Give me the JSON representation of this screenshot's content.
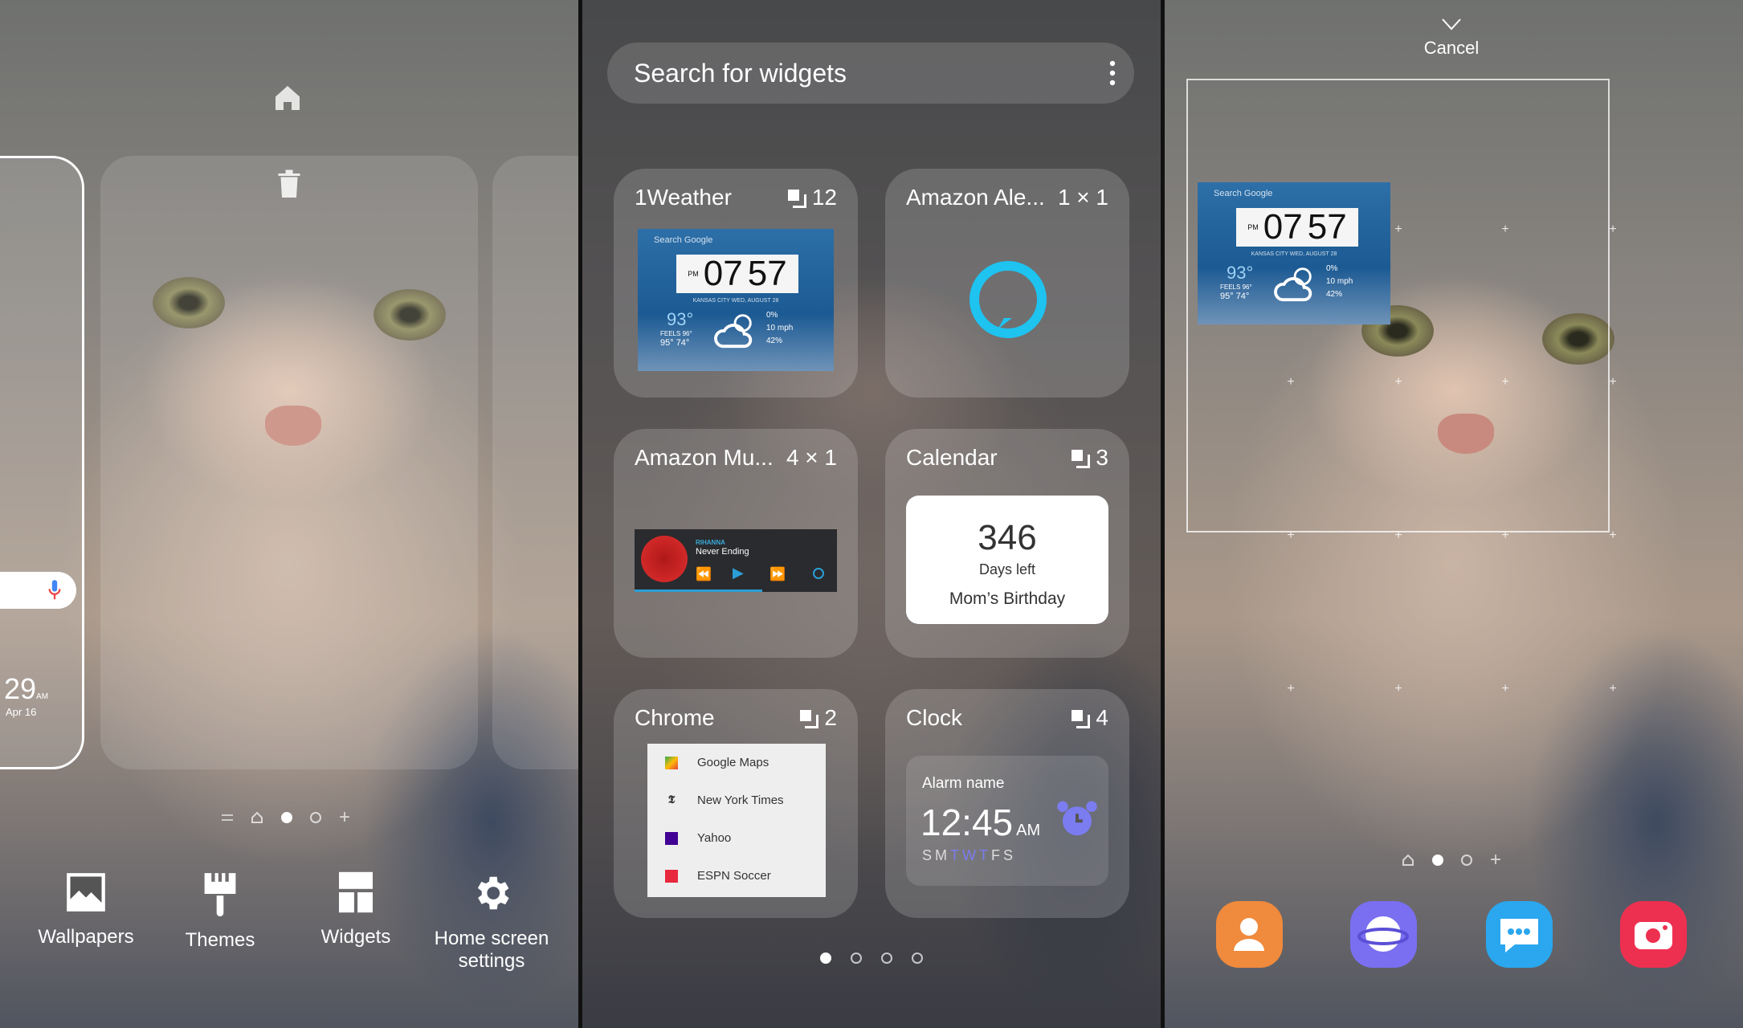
{
  "left_panel": {
    "clock_time": "29",
    "clock_ampm": "AM",
    "clock_date": "Apr 16",
    "bottom_buttons": [
      {
        "label": "Wallpapers",
        "icon": "image-icon"
      },
      {
        "label": "Themes",
        "icon": "paintbrush-icon"
      },
      {
        "label": "Widgets",
        "icon": "widgets-icon"
      },
      {
        "label": "Home screen settings",
        "icon": "gear-icon"
      }
    ],
    "page_indicator": {
      "pages": 2,
      "active": 1
    }
  },
  "middle_panel": {
    "search_placeholder": "Search for widgets",
    "widgets": [
      {
        "name": "1Weather",
        "count": "12"
      },
      {
        "name": "Amazon Ale...",
        "size": "1 × 1"
      },
      {
        "name": "Amazon Mu...",
        "size": "4 × 1"
      },
      {
        "name": "Calendar",
        "count": "3"
      },
      {
        "name": "Chrome",
        "count": "2"
      },
      {
        "name": "Clock",
        "count": "4"
      }
    ],
    "weather_preview": {
      "search": "Search Google",
      "hour": "07",
      "minute": "57",
      "ampm": "PM",
      "location_date": "KANSAS CITY WED, AUGUST 28",
      "temp": "93°",
      "feels": "FEELS 96°",
      "hilo": "95° 74°",
      "precip": "0%",
      "wind": "10 mph",
      "humidity": "42%"
    },
    "music_preview": {
      "artist": "RIHANNA",
      "song": "Never Ending",
      "progress": 0.63
    },
    "calendar_preview": {
      "days": "346",
      "days_label": "Days left",
      "event": "Mom’s Birthday"
    },
    "chrome_preview": [
      "Google Maps",
      "New York Times",
      "Yahoo",
      "ESPN Soccer"
    ],
    "clock_preview": {
      "alarm_name": "Alarm name",
      "time": "12:45",
      "ampm": "AM",
      "days": [
        "S",
        "M",
        "T",
        "W",
        "T",
        "F",
        "S"
      ],
      "active_days": [
        2,
        3,
        4
      ]
    },
    "page_indicator": {
      "pages": 4,
      "active": 0
    },
    "accent_alexa": "#1ec3f0",
    "accent_alarm": "#7b7cf0"
  },
  "right_panel": {
    "cancel_label": "Cancel",
    "dock_apps": [
      {
        "icon": "contacts-icon",
        "color": "#f08a3c"
      },
      {
        "icon": "internet-icon",
        "color": "#7a6ff0"
      },
      {
        "icon": "messages-icon",
        "color": "#2aa7ee"
      },
      {
        "icon": "camera-icon",
        "color": "#ee3050"
      }
    ]
  }
}
